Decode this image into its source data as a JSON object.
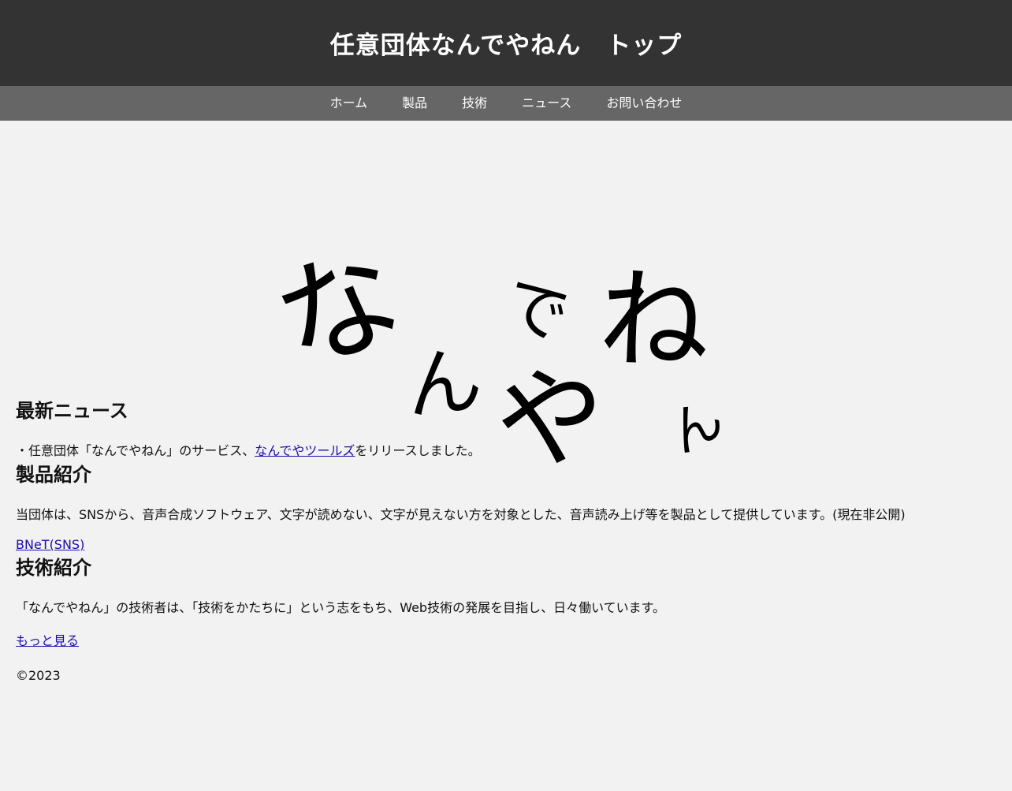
{
  "header": {
    "title": "任意団体なんでやねん　トップ"
  },
  "nav": {
    "items": [
      "ホーム",
      "製品",
      "技術",
      "ニュース",
      "お問い合わせ"
    ]
  },
  "hero": {
    "chars": [
      "な",
      "ん",
      "で",
      "や",
      "ね",
      "ん"
    ]
  },
  "news": {
    "heading": "最新ニュース",
    "item_prefix": "・任意団体「なんでやねん」のサービス、",
    "item_link": "なんでやツールズ",
    "item_suffix": "をリリースしました。"
  },
  "products": {
    "heading": "製品紹介",
    "description": "当団体は、SNSから、音声合成ソフトウェア、文字が読めない、文字が見えない方を対象とした、音声読み上げ等を製品として提供しています。(現在非公開)",
    "link": "BNeT(SNS)"
  },
  "tech": {
    "heading": "技術紹介",
    "description": "「なんでやねん」の技術者は、「技術をかたちに」という志をもち、Web技術の発展を目指し、日々働いています。",
    "link": "もっと見る"
  },
  "footer": {
    "partial_text": "©2023"
  },
  "colors": {
    "header_bg": "#333333",
    "nav_bg": "#666666",
    "page_bg": "#f2f2f2",
    "link": "#1a0dab"
  }
}
